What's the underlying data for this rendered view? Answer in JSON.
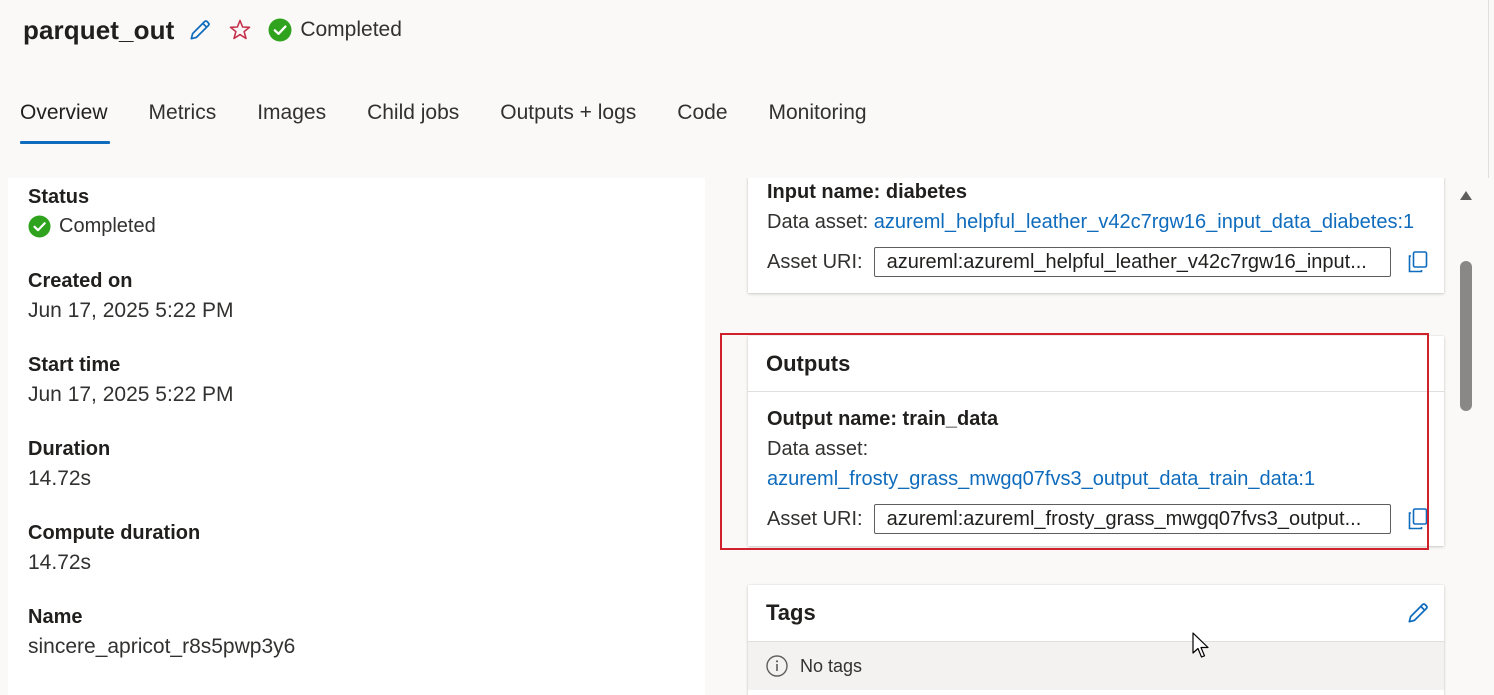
{
  "header": {
    "title": "parquet_out",
    "status": "Completed"
  },
  "tabs": [
    {
      "label": "Overview",
      "active": true
    },
    {
      "label": "Metrics"
    },
    {
      "label": "Images"
    },
    {
      "label": "Child jobs"
    },
    {
      "label": "Outputs + logs"
    },
    {
      "label": "Code"
    },
    {
      "label": "Monitoring"
    }
  ],
  "properties": {
    "status_label": "Status",
    "status_value": "Completed",
    "created_label": "Created on",
    "created_value": "Jun 17, 2025 5:22 PM",
    "start_label": "Start time",
    "start_value": "Jun 17, 2025 5:22 PM",
    "duration_label": "Duration",
    "duration_value": "14.72s",
    "compute_label": "Compute duration",
    "compute_value": "14.72s",
    "name_label": "Name",
    "name_value": "sincere_apricot_r8s5pwp3y6"
  },
  "inputs": {
    "input_name": "Input name: diabetes",
    "data_asset_label": "Data asset:",
    "data_asset_link": "azureml_helpful_leather_v42c7rgw16_input_data_diabetes:1",
    "asset_uri_label": "Asset URI:",
    "asset_uri_value": "azureml:azureml_helpful_leather_v42c7rgw16_input..."
  },
  "outputs": {
    "title": "Outputs",
    "output_name": "Output name: train_data",
    "data_asset_label": "Data asset:",
    "data_asset_link": "azureml_frosty_grass_mwgq07fvs3_output_data_train_data:1",
    "asset_uri_label": "Asset URI:",
    "asset_uri_value": "azureml:azureml_frosty_grass_mwgq07fvs3_output..."
  },
  "tags": {
    "title": "Tags",
    "empty_text": "No tags"
  },
  "colors": {
    "accent": "#0f6cbd",
    "success": "#2fa31d",
    "star": "#c4314b",
    "highlight": "#d0202c"
  }
}
